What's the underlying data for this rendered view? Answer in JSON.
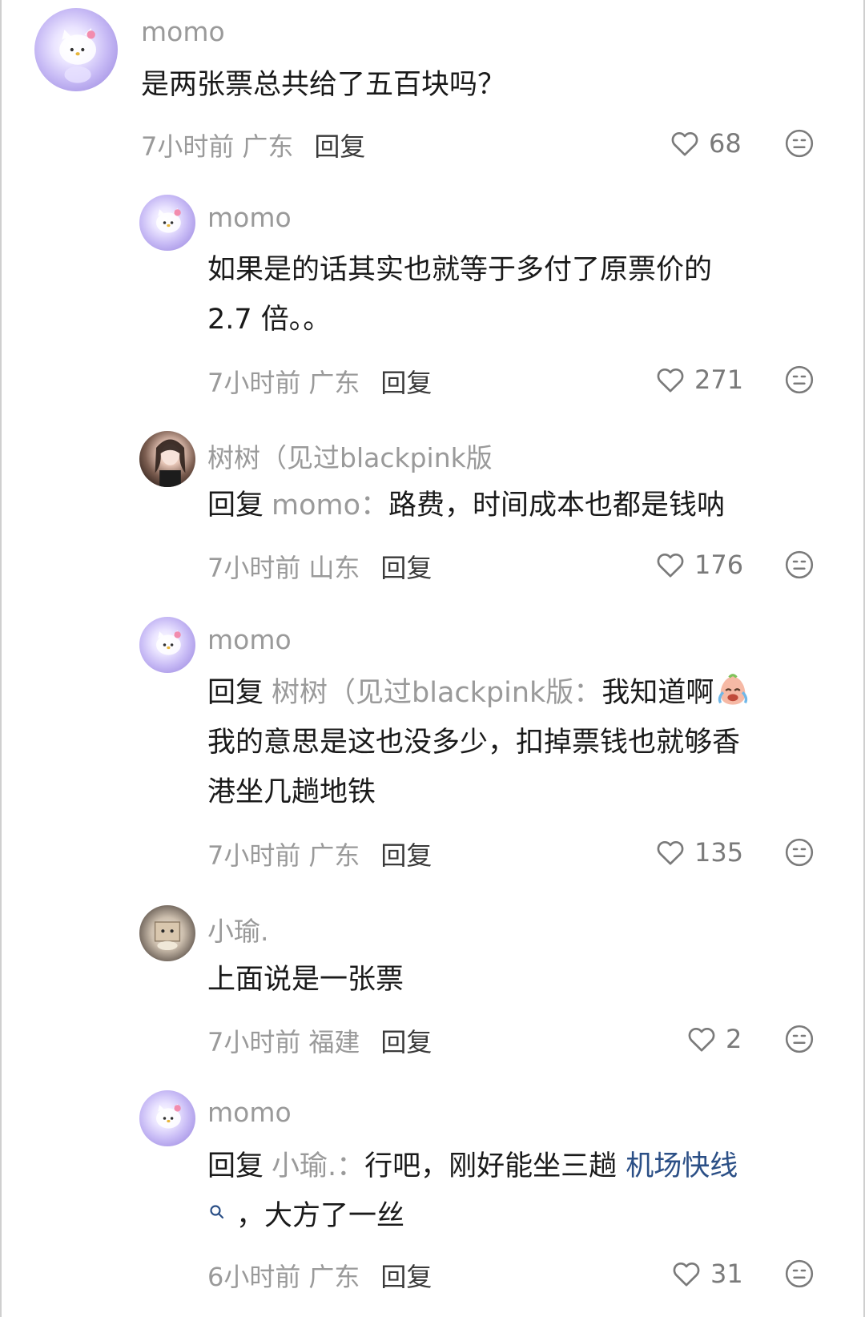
{
  "comments": [
    {
      "author": "momo",
      "text_lines": [
        "是两张票总共给了五百块吗？"
      ],
      "time": "7小时前",
      "location": "广东",
      "reply_label": "回复",
      "likes": "68"
    },
    {
      "author": "momo",
      "text_lines": [
        "如果是的话其实也就等于多付了原票价的",
        "2.7 倍。。"
      ],
      "time": "7小时前",
      "location": "广东",
      "reply_label": "回复",
      "likes": "271"
    },
    {
      "author": "树树（见过blackpink版",
      "reply_prefix": "回复",
      "reply_target": "momo：",
      "text_lines": [
        "路费，时间成本也都是钱呐"
      ],
      "time": "7小时前",
      "location": "山东",
      "reply_label": "回复",
      "likes": "176"
    },
    {
      "author": "momo",
      "reply_prefix": "回复",
      "reply_target": "树树（见过blackpink版：",
      "text_lines": [
        "我知道啊",
        "我的意思是这也没多少，扣掉票钱也就够香",
        "港坐几趟地铁"
      ],
      "time": "7小时前",
      "location": "广东",
      "reply_label": "回复",
      "likes": "135"
    },
    {
      "author": "小瑜.",
      "text_lines": [
        "上面说是一张票"
      ],
      "time": "7小时前",
      "location": "福建",
      "reply_label": "回复",
      "likes": "2"
    },
    {
      "author": "momo",
      "reply_prefix": "回复",
      "reply_target": "小瑜.：",
      "text_lines": [
        "行吧，刚好能坐三趟 ",
        "，大方了一丝"
      ],
      "link_text": "机场快线",
      "time": "6小时前",
      "location": "广东",
      "reply_label": "回复",
      "likes": "31"
    }
  ],
  "icons": {
    "like": "heart-outline-icon",
    "react": "meh-face-icon",
    "inline_emoji": "crying-laughing-emoji",
    "search_link": "search-icon"
  },
  "colors": {
    "name_gray": "#9a9a9a",
    "text": "#1a1a1a",
    "link_blue": "#2b4f86"
  }
}
